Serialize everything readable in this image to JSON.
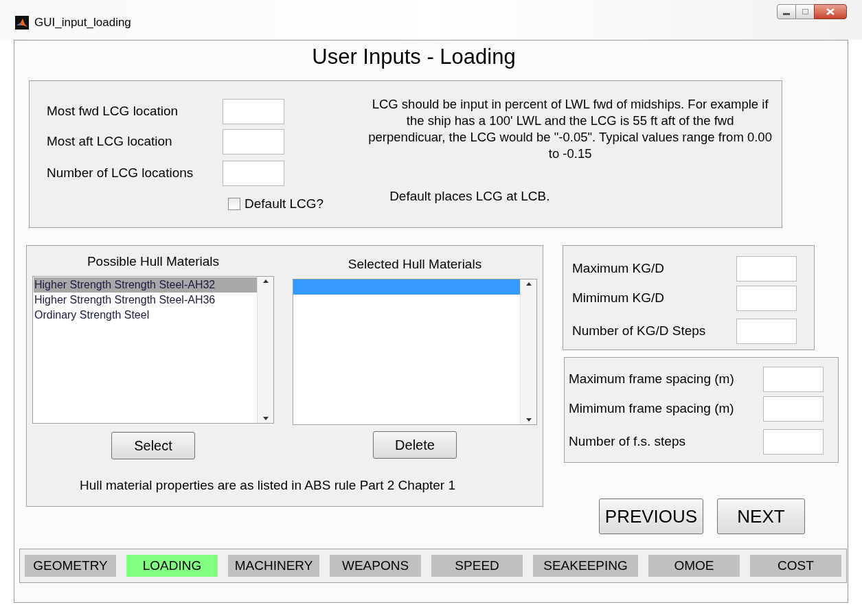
{
  "window": {
    "title": "GUI_input_loading"
  },
  "heading": "User Inputs - Loading",
  "lcg_panel": {
    "fields": [
      {
        "label": "Most fwd LCG location"
      },
      {
        "label": "Most aft LCG location"
      },
      {
        "label": "Number of LCG locations"
      }
    ],
    "note": "LCG should be input in percent of LWL fwd of midships.  For example if the ship has a 100'  LWL and the LCG is 55 ft aft of the fwd perpendicuar, the LCG would be \"-0.05\". Typical values range from 0.00 to -0.15",
    "checkbox": {
      "label": "Default LCG?",
      "checked": false
    },
    "default_note": "Default places LCG at LCB."
  },
  "materials_panel": {
    "possible": {
      "heading": "Possible Hull Materials",
      "items": [
        {
          "label": "Higher Strength Strength Steel-AH32",
          "selected": true
        },
        {
          "label": "Higher Strength Strength Steel-AH36",
          "selected": false
        },
        {
          "label": "Ordinary Strength Steel",
          "selected": false
        }
      ],
      "button": "Select"
    },
    "chosen": {
      "heading": "Selected Hull Materials",
      "empty_row_highlighted": true,
      "button": "Delete"
    },
    "note": "Hull material properties are as listed in ABS rule Part 2 Chapter 1"
  },
  "kg_panel": {
    "fields": [
      {
        "label": "Maximum KG/D"
      },
      {
        "label": "Mimimum KG/D"
      },
      {
        "label": "Number of KG/D Steps"
      }
    ]
  },
  "frame_panel": {
    "fields": [
      {
        "label": "Maximum frame spacing (m)"
      },
      {
        "label": "Mimimum frame spacing (m)"
      },
      {
        "label": "Number of f.s. steps"
      }
    ]
  },
  "nav_buttons": [
    "PREVIOUS",
    "NEXT"
  ],
  "tabs": [
    {
      "label": "GEOMETRY",
      "selected": false
    },
    {
      "label": "LOADING",
      "selected": true
    },
    {
      "label": "MACHINERY",
      "selected": false
    },
    {
      "label": "WEAPONS",
      "selected": false
    },
    {
      "label": "SPEED",
      "selected": false
    },
    {
      "label": "SEAKEEPING",
      "selected": false
    },
    {
      "label": "OMOE",
      "selected": false
    },
    {
      "label": "COST",
      "selected": false
    }
  ]
}
